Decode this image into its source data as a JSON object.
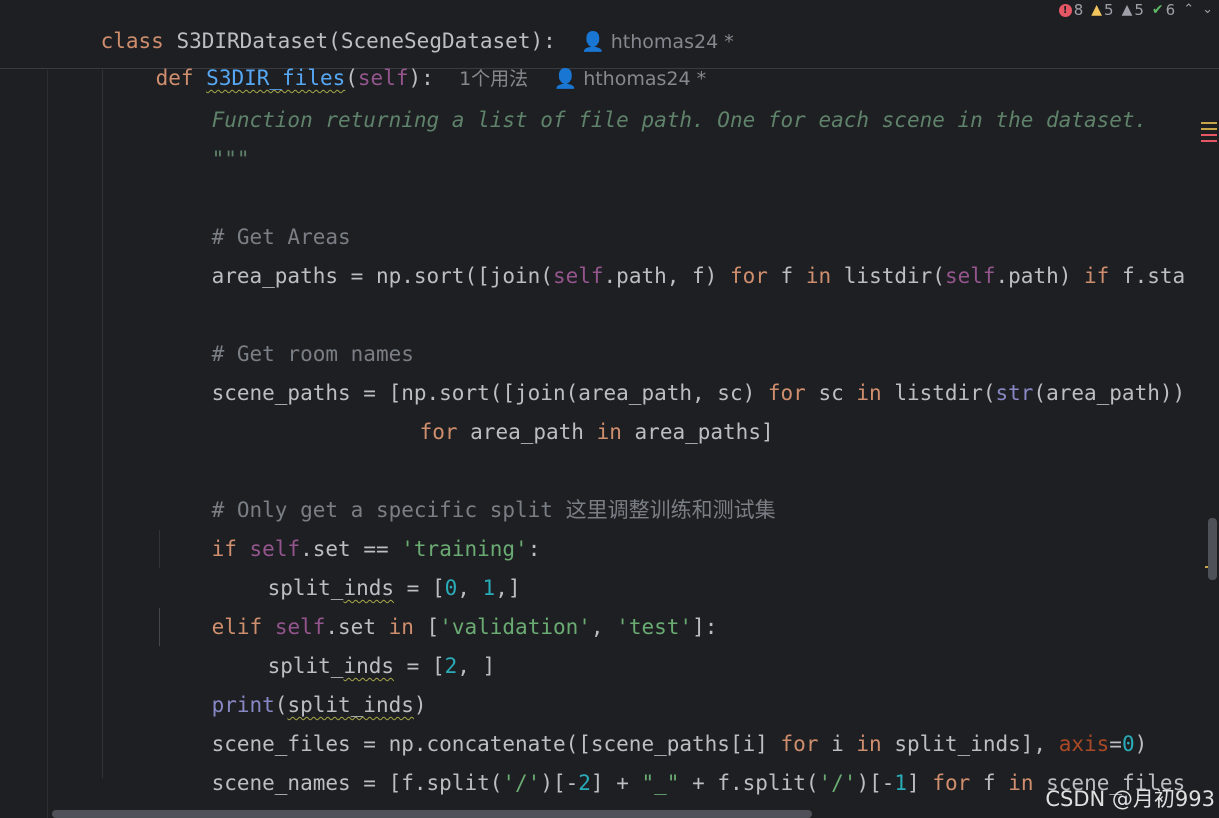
{
  "sticky": {
    "class_keyword": "class",
    "class_name": "S3DIRDataset",
    "class_parent": "(SceneSegDataset):",
    "class_author": "hthomas24 *",
    "def_keyword": "def",
    "def_name": "S3DIR_files",
    "def_params_open": "(",
    "def_self": "self",
    "def_params_close": "):",
    "usages": "1个用法",
    "def_author": "hthomas24 *"
  },
  "inspections": {
    "errors": "8",
    "warnings": "5",
    "weak_warnings": "5",
    "typos": "6"
  },
  "code": {
    "l1": "Function returning a list of file path. One for each scene in the dataset.",
    "l2": "\"\"\"",
    "l3": "# Get Areas",
    "l4_a": "area_paths = np.sort([join(",
    "l4_self1": "self",
    "l4_b": ".path, f) ",
    "l4_for": "for",
    "l4_c": " f ",
    "l4_in": "in",
    "l4_d": " listdir(",
    "l4_self2": "self",
    "l4_e": ".path) ",
    "l4_if": "if",
    "l4_f": " f.sta",
    "l5": "# Get room names",
    "l6_a": "scene_paths = [np.sort([join(area_path, sc) ",
    "l6_for": "for",
    "l6_b": " sc ",
    "l6_in": "in",
    "l6_c": " listdir(",
    "l6_str": "str",
    "l6_d": "(area_path))",
    "l7_for": "for",
    "l7_a": " area_path ",
    "l7_in": "in",
    "l7_b": " area_paths]",
    "l8": "# Only get a specific split 这里调整训练和测试集",
    "l9_if": "if",
    "l9_self": "self",
    "l9_a": ".set == ",
    "l9_str": "'training'",
    "l9_b": ":",
    "l10_a": "split_",
    "l10_b": "inds",
    "l10_c": " = [",
    "l10_n0": "0",
    "l10_d": ", ",
    "l10_n1": "1",
    "l10_e": ",]",
    "l11_elif": "elif",
    "l11_self": "self",
    "l11_a": ".set ",
    "l11_in": "in",
    "l11_b": " [",
    "l11_s1": "'validation'",
    "l11_c": ", ",
    "l11_s2": "'test'",
    "l11_d": "]:",
    "l12_a": "split_",
    "l12_b": "inds",
    "l12_c": " = [",
    "l12_n": "2",
    "l12_d": ", ]",
    "l13_print": "print",
    "l13_a": "(",
    "l13_b": "split_inds",
    "l13_c": ")",
    "l14_a": "scene_files = np.concatenate([scene_paths[i] ",
    "l14_for": "for",
    "l14_b": " i ",
    "l14_in": "in",
    "l14_c": " split_inds], ",
    "l14_axis": "axis",
    "l14_d": "=",
    "l14_n": "0",
    "l14_e": ")",
    "l15_a": "scene_names = [f.split(",
    "l15_s1": "'/'",
    "l15_b": ")[-",
    "l15_n1": "2",
    "l15_c": "] + ",
    "l15_s2": "\"_\"",
    "l15_d": " + f.split(",
    "l15_s3": "'/'",
    "l15_e": ")[-",
    "l15_n2": "1",
    "l15_f": "] ",
    "l15_for": "for",
    "l15_g": " f ",
    "l15_in": "in",
    "l15_h": " scene_files"
  },
  "watermark": "CSDN @月初993",
  "colors": {
    "background": "#1e1f22",
    "keyword": "#cf8e6d",
    "function": "#56a8f5",
    "self": "#94558d",
    "string": "#6aab73",
    "number": "#2aacb8",
    "comment": "#7a7e85",
    "docstring": "#5f826b"
  }
}
